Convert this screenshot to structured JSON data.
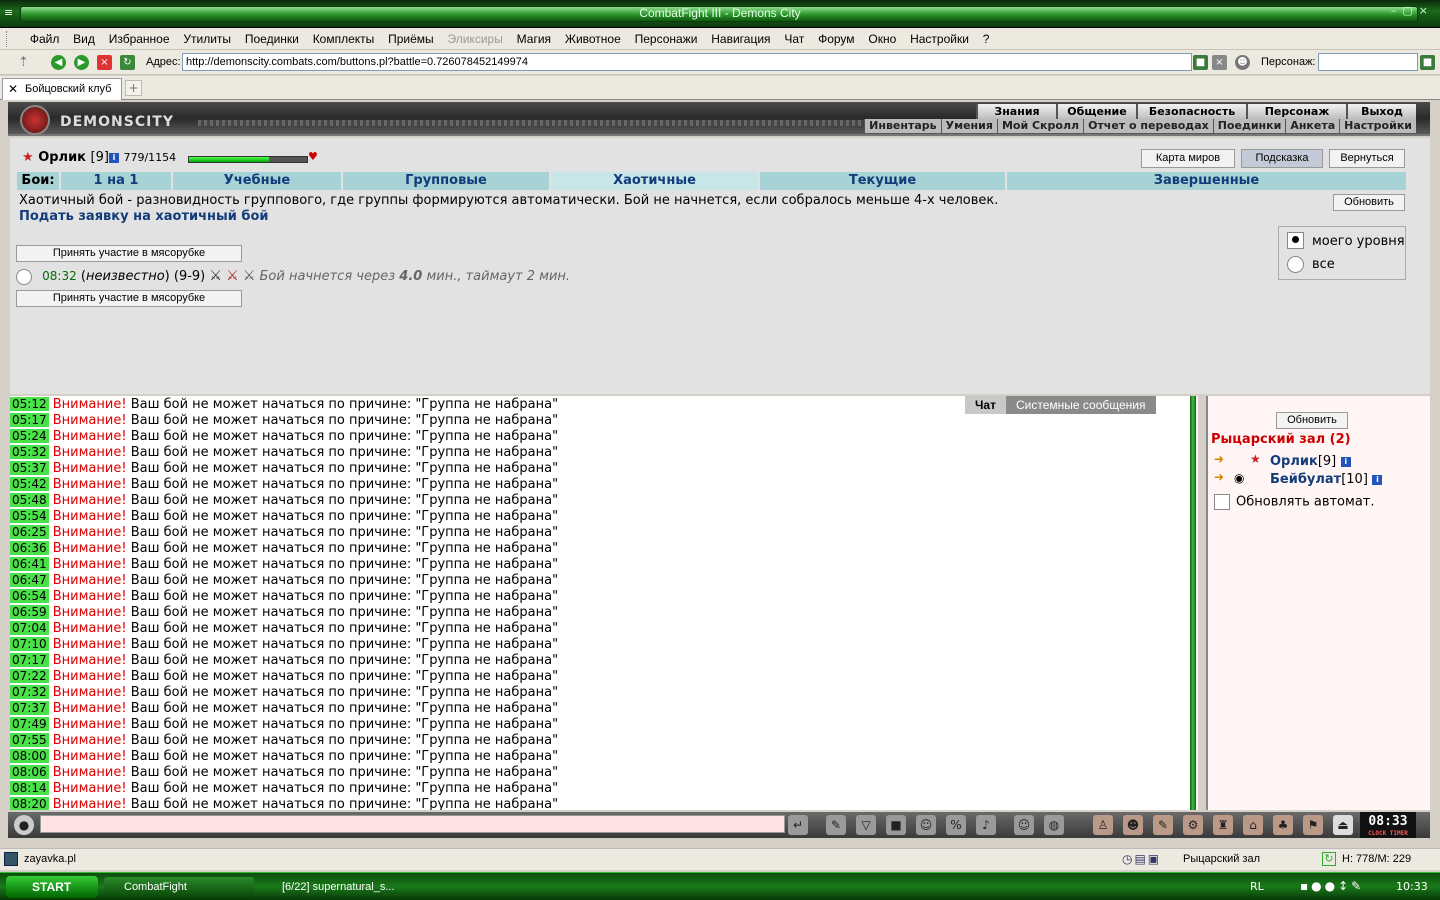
{
  "window": {
    "title": "CombatFight III - Demons City",
    "sys_icon": "≡"
  },
  "menu": [
    "Файл",
    "Вид",
    "Избранное",
    "Утилиты",
    "Поединки",
    "Комплекты",
    "Приёмы",
    "Эликсиры",
    "Магия",
    "Животное",
    "Персонажи",
    "Навигация",
    "Чат",
    "Форум",
    "Окно",
    "Настройки",
    "?"
  ],
  "toolbar": {
    "address_label": "Адрес:",
    "url": "http://demonscity.combats.com/buttons.pl?battle=0.726078452149974",
    "persona_label": "Персонаж:"
  },
  "tabs": {
    "active": "Бойцовский клуб"
  },
  "banner": {
    "logo": "DEMONSCITY",
    "nav_top": [
      "Знания",
      "Общение",
      "Безопасность",
      "Персонаж",
      "Выход"
    ],
    "nav_bottom": [
      "Инвентарь",
      "Умения",
      "Мой Скролл",
      "Отчет о переводах",
      "Поединки",
      "Анкета",
      "Настройки"
    ]
  },
  "player": {
    "name": "Орлик",
    "level": "[9]",
    "hp": "779/1154",
    "hp_fraction": 0.675
  },
  "top_buttons": {
    "map": "Карта миров",
    "hint": "Подсказка",
    "back": "Вернуться"
  },
  "fight_tabs": {
    "label": "Бои:",
    "items": [
      "1 на 1",
      "Учебные",
      "Групповые",
      "Хаотичные",
      "Текущие",
      "Завершенные"
    ],
    "active": "Хаотичные"
  },
  "chaotic": {
    "description": "Хаотичный бой - разновидность группового, где группы формируются автоматически. Бой не начнется, если собралось меньше 4-х человек.",
    "apply_link": "Подать заявку на хаотичный бой",
    "refresh": "Обновить",
    "join_button": "Принять участие в мясорубке",
    "fight_time": "08:32",
    "fight_who": "неизвестно",
    "fight_levels": "(9-9)",
    "fight_starts": "Бой начнется через",
    "fight_minutes": "4.0",
    "fight_min_unit": "мин., таймаут 2 мин.",
    "filter_my_level": "моего уровня",
    "filter_all": "все"
  },
  "chat": {
    "tabs": [
      "Чат",
      "Системные сообщения"
    ],
    "warn": "Внимание!",
    "msg": "Ваш бой не может начаться по причине: \"Группа не набрана\"",
    "times": [
      "05:12",
      "05:17",
      "05:24",
      "05:32",
      "05:37",
      "05:42",
      "05:48",
      "05:54",
      "06:25",
      "06:36",
      "06:41",
      "06:47",
      "06:54",
      "06:59",
      "07:04",
      "07:10",
      "07:17",
      "07:22",
      "07:32",
      "07:37",
      "07:49",
      "07:55",
      "08:00",
      "08:06",
      "08:14",
      "08:20"
    ]
  },
  "room": {
    "refresh": "Обновить",
    "title": "Рыцарский зал (2)",
    "users": [
      {
        "name": "Орлик",
        "level": "[9]"
      },
      {
        "name": "Бейбулат",
        "level": "[10]"
      }
    ],
    "auto_refresh": "Обновлять автомат."
  },
  "bottom": {
    "clock": "08:33",
    "clock_sub": "CLOCK TIMER"
  },
  "statusbar": {
    "file": "zayavka.pl",
    "room": "Рыцарский зал",
    "hm": "H: 778/M: 229"
  },
  "taskbar": {
    "start": "START",
    "task1": "CombatFight",
    "task2": "[6/22] supernatural_s...",
    "lang": "RL",
    "time": "10:33"
  }
}
